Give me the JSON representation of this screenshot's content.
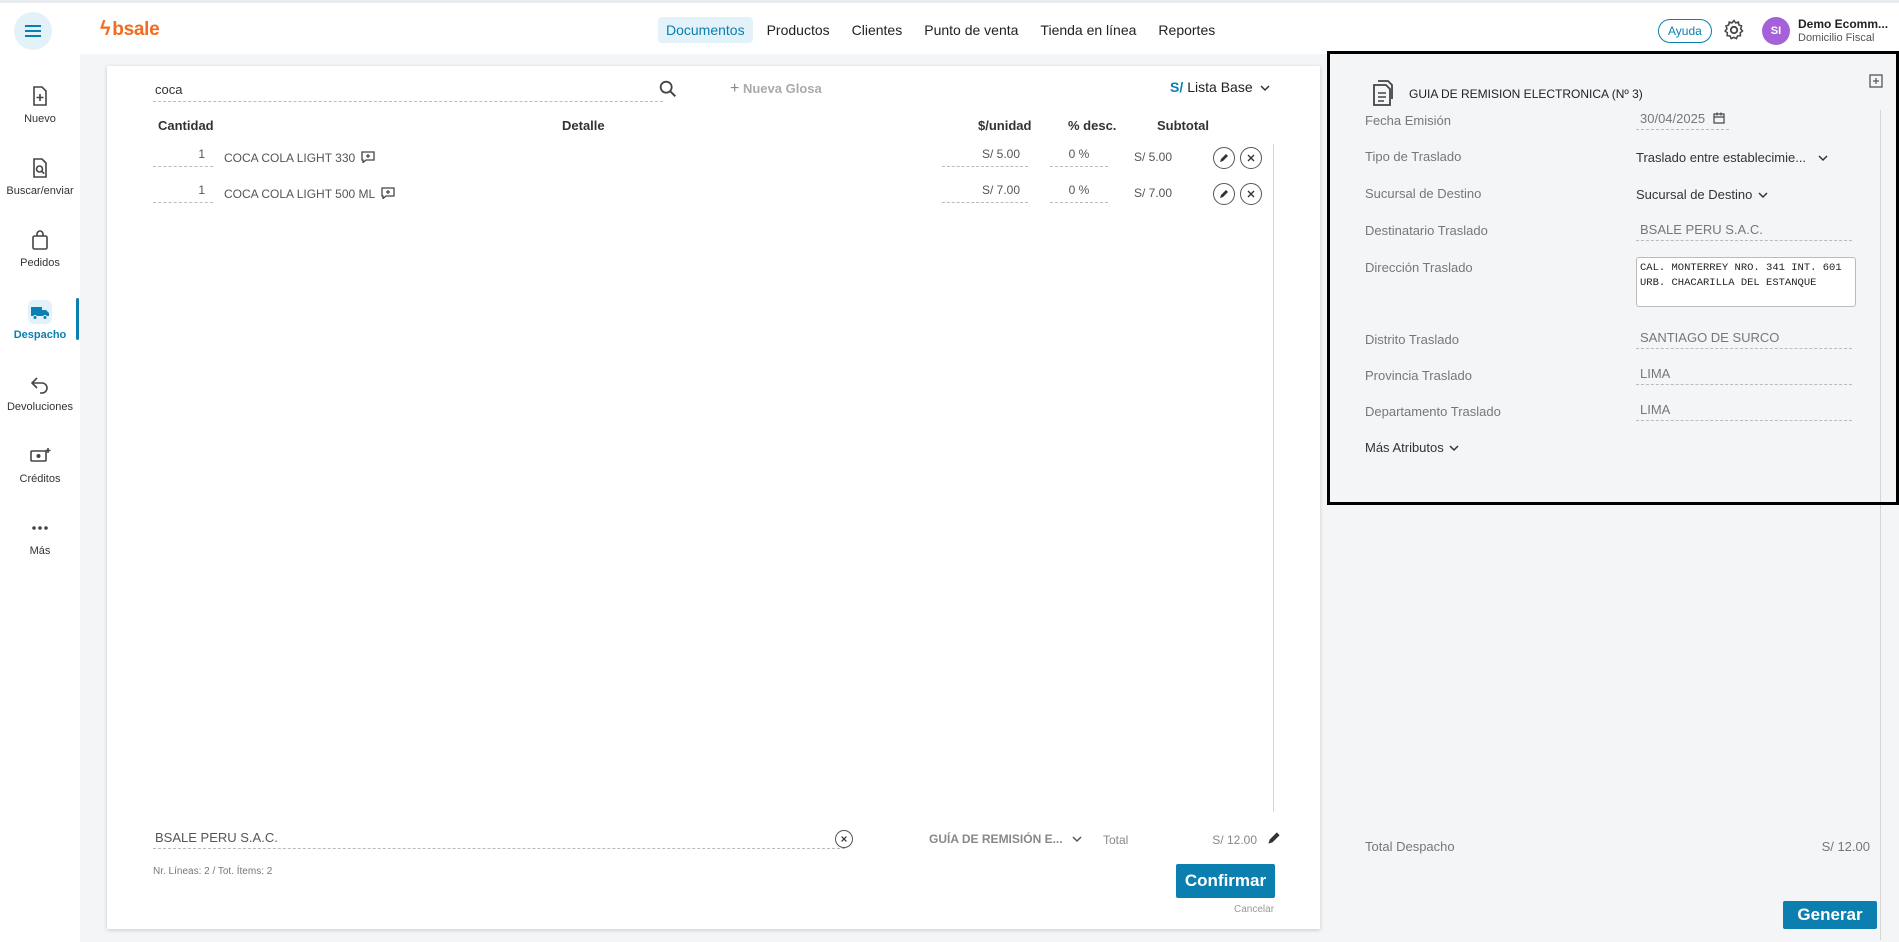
{
  "header": {
    "logo": "bsale",
    "nav": [
      "Documentos",
      "Productos",
      "Clientes",
      "Punto de venta",
      "Tienda en línea",
      "Reportes"
    ],
    "active_nav": "Documentos",
    "help_label": "Ayuda",
    "avatar_initials": "SI",
    "user_name": "Demo Ecomm...",
    "user_sub": "Domicilio Fiscal"
  },
  "sidebar": {
    "items": [
      {
        "label": "Nuevo",
        "icon": "file-plus-icon"
      },
      {
        "label": "Buscar/enviar",
        "icon": "file-search-icon"
      },
      {
        "label": "Pedidos",
        "icon": "shopping-bag-icon"
      },
      {
        "label": "Despacho",
        "icon": "truck-icon"
      },
      {
        "label": "Devoluciones",
        "icon": "return-arrow-icon"
      },
      {
        "label": "Créditos",
        "icon": "money-plus-icon"
      },
      {
        "label": "Más",
        "icon": "more-dots-icon"
      }
    ],
    "active": "Despacho"
  },
  "document": {
    "search_value": "coca",
    "nueva_glosa": "Nueva Glosa",
    "price_list_currency": "S/",
    "price_list": "Lista Base",
    "columns": {
      "cantidad": "Cantidad",
      "detalle": "Detalle",
      "unidad": "$/unidad",
      "desc": "% desc.",
      "subtotal": "Subtotal"
    },
    "rows": [
      {
        "qty": "1",
        "detail": "COCA COLA LIGHT 330",
        "price": "S/ 5.00",
        "disc": "0 %",
        "subtotal": "S/ 5.00"
      },
      {
        "qty": "1",
        "detail": "COCA COLA LIGHT 500 ML",
        "price": "S/ 7.00",
        "disc": "0 %",
        "subtotal": "S/ 7.00"
      }
    ],
    "client": "BSALE PERU S.A.C.",
    "doc_type": "GUÍA DE REMISIÓN E...",
    "total_label": "Total",
    "total_value": "S/ 12.00",
    "lines_info": "Nr. Líneas: 2 / Tot. Ítems: 2",
    "confirm_label": "Confirmar",
    "cancel_label": "Cancelar"
  },
  "guia": {
    "title": "GUIA DE REMISION ELECTRONICA (Nº 3)",
    "fields": {
      "fecha_label": "Fecha Emisión",
      "fecha_value": "30/04/2025",
      "tipo_label": "Tipo de Traslado",
      "tipo_value": "Traslado entre establecimie...",
      "sucursal_label": "Sucursal de Destino",
      "sucursal_value": "Sucursal de Destino",
      "destinatario_label": "Destinatario Traslado",
      "destinatario_value": "BSALE PERU S.A.C.",
      "direccion_label": "Dirección Traslado",
      "direccion_value": "CAL. MONTERREY NRO. 341 INT. 601\nURB. CHACARILLA DEL ESTANQUE",
      "distrito_label": "Distrito Traslado",
      "distrito_value": "SANTIAGO DE SURCO",
      "provincia_label": "Provincia Traslado",
      "provincia_value": "LIMA",
      "departamento_label": "Departamento Traslado",
      "departamento_value": "LIMA"
    },
    "mas_atributos": "Más Atributos",
    "total_despacho_label": "Total Despacho",
    "total_despacho_value": "S/ 12.00",
    "generar_label": "Generar"
  },
  "colors": {
    "accent": "#0a7fb0",
    "brand": "#f26b21",
    "avatar": "#a562d8"
  }
}
